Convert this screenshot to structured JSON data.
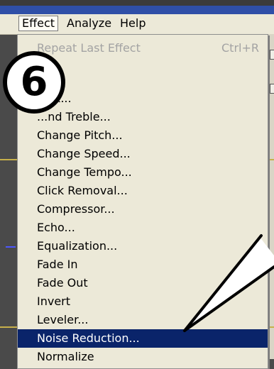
{
  "menubar": {
    "items": [
      "Effect",
      "Analyze",
      "Help"
    ]
  },
  "menu": {
    "items": [
      {
        "label": "Repeat Last Effect",
        "shortcut": "Ctrl+R",
        "state": "disabled"
      },
      {
        "label": "...",
        "shortcut": "",
        "state": "normal"
      },
      {
        "label": "...ck...",
        "shortcut": "",
        "state": "normal"
      },
      {
        "label": "...nd Treble...",
        "shortcut": "",
        "state": "normal"
      },
      {
        "label": "Change Pitch...",
        "shortcut": "",
        "state": "normal"
      },
      {
        "label": "Change Speed...",
        "shortcut": "",
        "state": "normal"
      },
      {
        "label": "Change Tempo...",
        "shortcut": "",
        "state": "normal"
      },
      {
        "label": "Click Removal...",
        "shortcut": "",
        "state": "normal"
      },
      {
        "label": "Compressor...",
        "shortcut": "",
        "state": "normal"
      },
      {
        "label": "Echo...",
        "shortcut": "",
        "state": "normal"
      },
      {
        "label": "Equalization...",
        "shortcut": "",
        "state": "normal"
      },
      {
        "label": "Fade In",
        "shortcut": "",
        "state": "normal"
      },
      {
        "label": "Fade Out",
        "shortcut": "",
        "state": "normal"
      },
      {
        "label": "Invert",
        "shortcut": "",
        "state": "normal"
      },
      {
        "label": "Leveler...",
        "shortcut": "",
        "state": "normal"
      },
      {
        "label": "Noise Reduction...",
        "shortcut": "",
        "state": "selected"
      },
      {
        "label": "Normalize",
        "shortcut": "",
        "state": "normal"
      }
    ]
  },
  "step_badge": {
    "number": "6"
  },
  "colors": {
    "selected_bg": "#0a246a",
    "menu_bg": "#ece9d8",
    "menubar_blue": "#2f4fa7"
  }
}
